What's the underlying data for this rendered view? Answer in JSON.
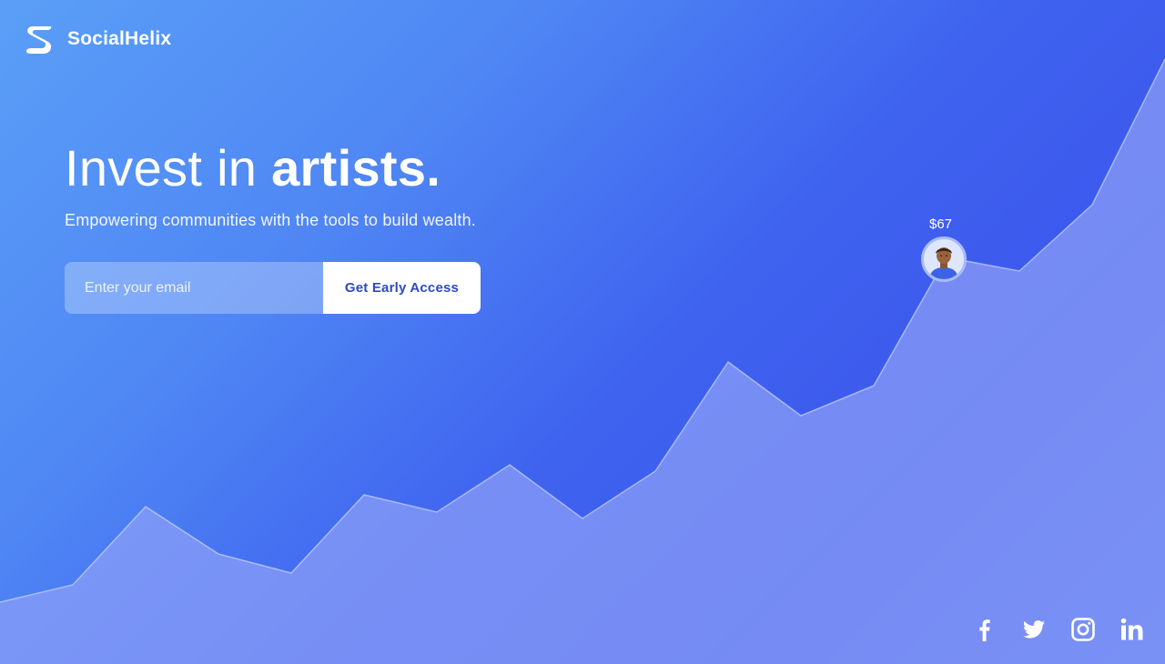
{
  "brand": {
    "name": "SocialHelix"
  },
  "hero": {
    "headline_light": "Invest in ",
    "headline_bold": "artists.",
    "subtitle": "Empowering communities with the tools to build wealth."
  },
  "signup": {
    "email_placeholder": "Enter your email",
    "email_value": "",
    "cta_label": "Get Early Access"
  },
  "highlight": {
    "price": "$67"
  },
  "social": [
    "facebook-icon",
    "twitter-icon",
    "instagram-icon",
    "linkedin-icon"
  ],
  "colors": {
    "cta_text": "#2c49c9",
    "gradient_start": "#5a9ff7",
    "gradient_end": "#3c58ee"
  }
}
